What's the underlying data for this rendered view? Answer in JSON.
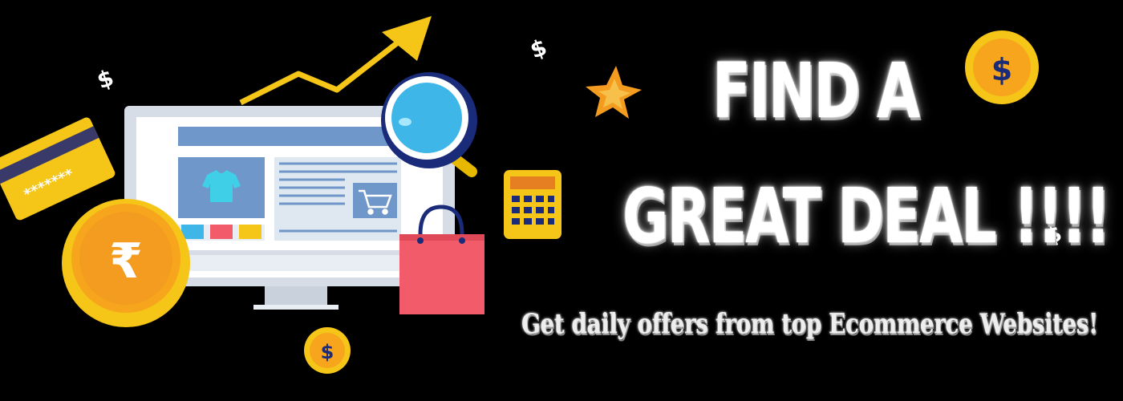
{
  "banner": {
    "headline_line1": "FIND A",
    "headline_line2": "GREAT DEAL !!!!",
    "tagline": "Get daily offers from top Ecommerce Websites!"
  },
  "art": {
    "card_number": "*******",
    "coin_symbol_dollar": "$",
    "coin_symbol_rupee": "₹",
    "floating_symbol": "$"
  },
  "colors": {
    "background": "#000000",
    "headline": "#ffffff",
    "coin_gold": "#f5c518",
    "coin_orange": "#f39c1f",
    "monitor_frame": "#d7dde6",
    "screen_blue": "#6f97c9",
    "bag_pink": "#f25c6a",
    "arrow_yellow": "#f5c518",
    "magnifier_blue": "#3fb6e8"
  },
  "icons": [
    "trend-arrow-icon",
    "magnifier-icon",
    "credit-card-icon",
    "rupee-coin-icon",
    "dollar-coin-icon",
    "shopping-bag-icon",
    "calculator-icon",
    "star-icon",
    "shirt-icon",
    "cart-icon"
  ]
}
